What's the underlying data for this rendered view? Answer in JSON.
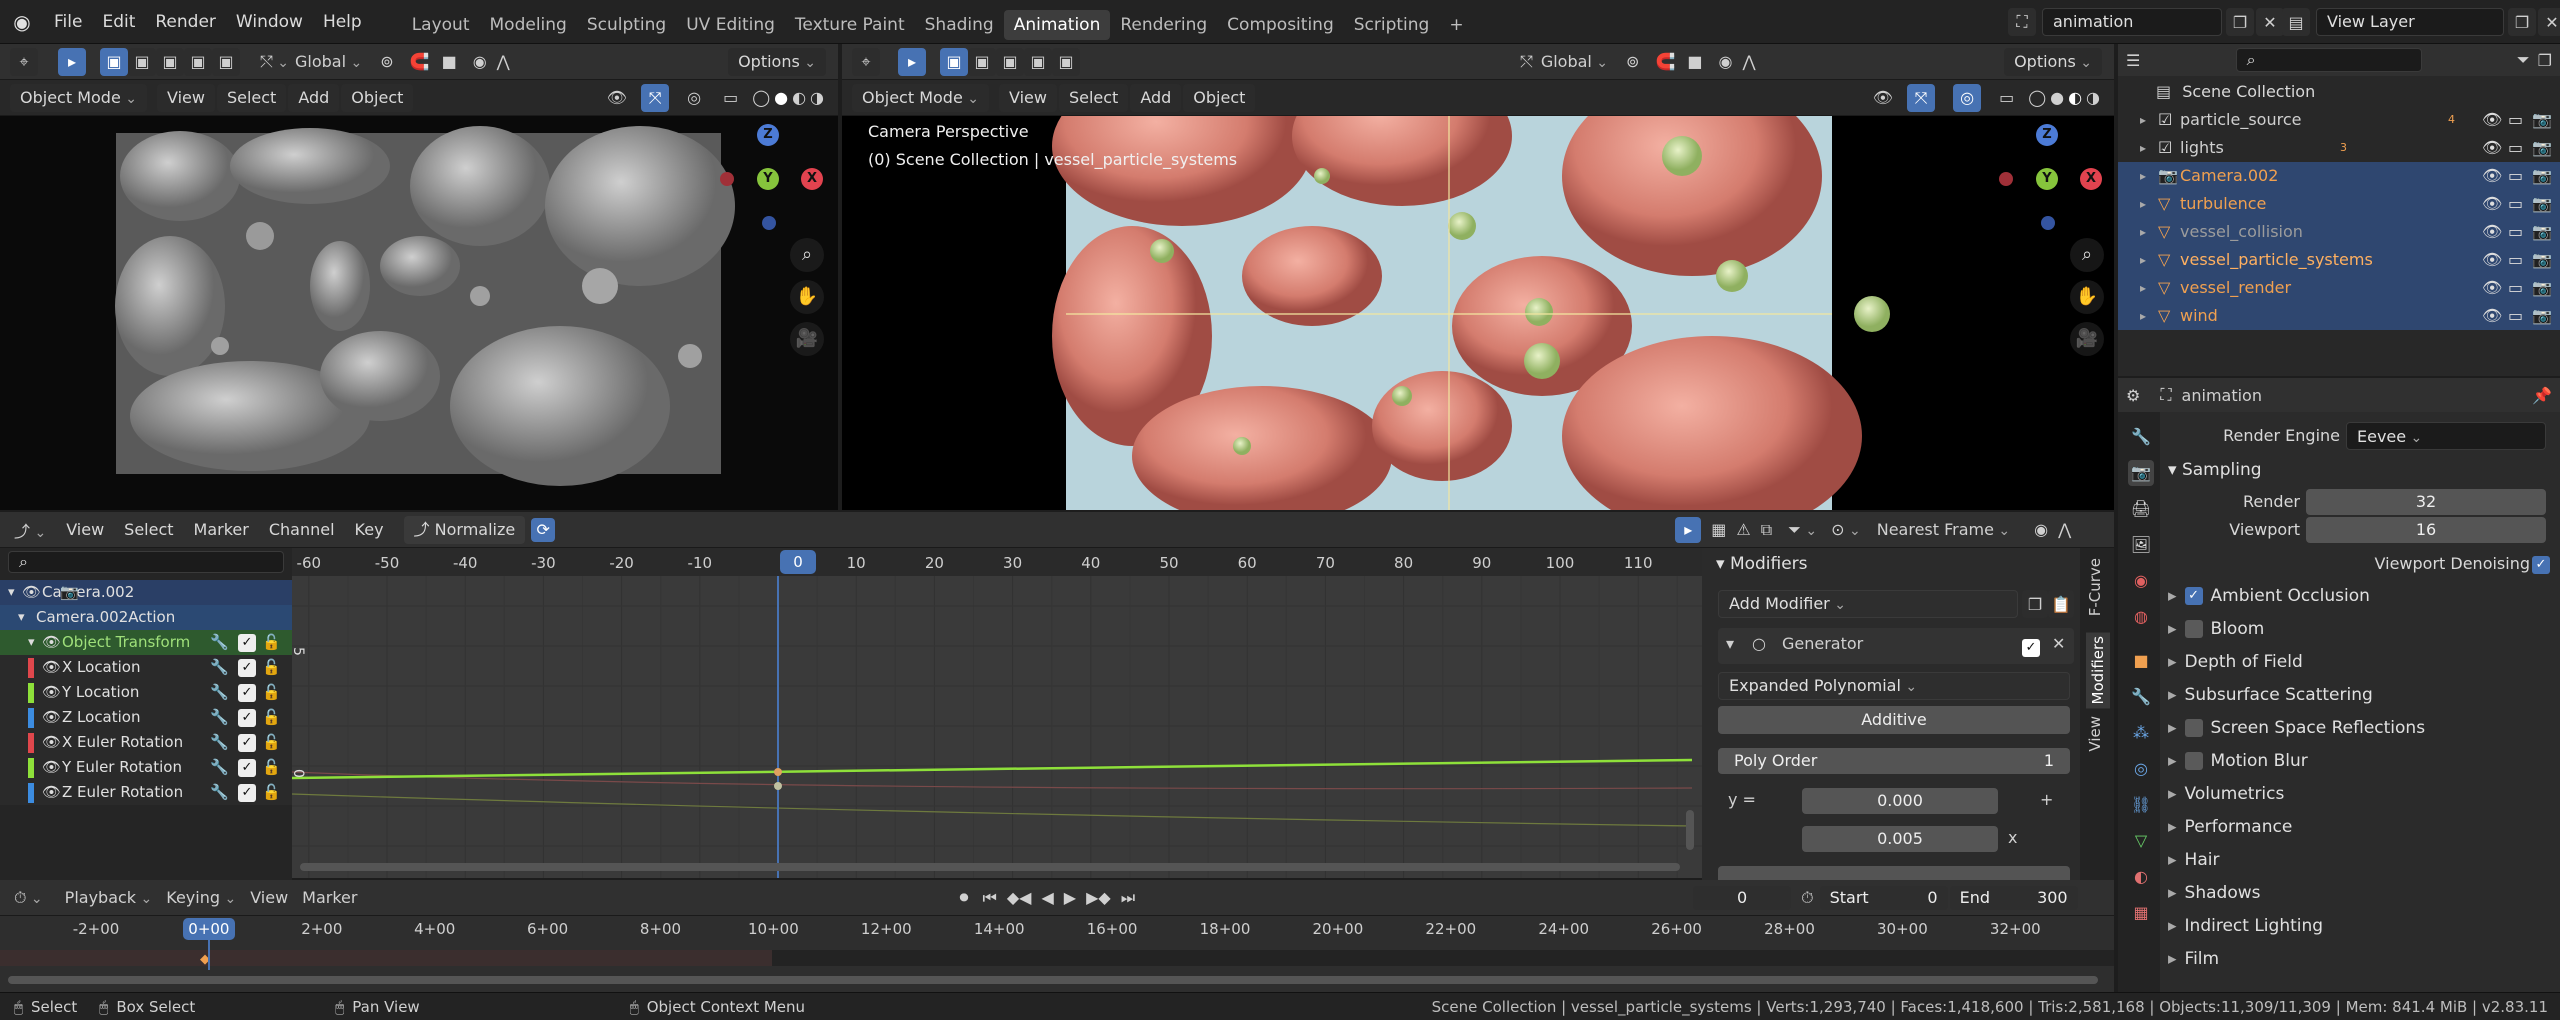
{
  "menubar": {
    "items": [
      "File",
      "Edit",
      "Render",
      "Window",
      "Help"
    ],
    "workspaces": [
      "Layout",
      "Modeling",
      "Sculpting",
      "UV Editing",
      "Texture Paint",
      "Shading",
      "Animation",
      "Rendering",
      "Compositing",
      "Scripting"
    ],
    "active_workspace": "Animation",
    "scene_name": "animation",
    "view_layer": "View Layer"
  },
  "viewport_left": {
    "transform_orientation": "Global",
    "options_label": "Options",
    "mode": "Object Mode",
    "menus": [
      "View",
      "Select",
      "Add",
      "Object"
    ],
    "gizmo": {
      "z": "Z",
      "y": "Y",
      "x": "X"
    }
  },
  "viewport_right": {
    "transform_orientation": "Global",
    "options_label": "Options",
    "mode": "Object Mode",
    "menus": [
      "View",
      "Select",
      "Add",
      "Object"
    ],
    "overlay_line1": "Camera Perspective",
    "overlay_line2": "(0) Scene Collection | vessel_particle_systems",
    "gizmo": {
      "z": "Z",
      "y": "Y",
      "x": "X"
    }
  },
  "outliner": {
    "root": "Scene Collection",
    "rows": [
      {
        "name": "particle_source",
        "selected": false,
        "color": "#d0d0d0",
        "badge": "4"
      },
      {
        "name": "lights",
        "selected": false,
        "color": "#d0d0d0",
        "badge": "3"
      },
      {
        "name": "Camera.002",
        "selected": true,
        "color": "#f0a050",
        "badge": ""
      },
      {
        "name": "turbulence",
        "selected": true,
        "color": "#f0a050",
        "badge": ""
      },
      {
        "name": "vessel_collision",
        "selected": true,
        "color": "#9c9c9c",
        "badge": ""
      },
      {
        "name": "vessel_particle_systems",
        "selected": true,
        "color": "#ffb060",
        "badge": ""
      },
      {
        "name": "vessel_render",
        "selected": true,
        "color": "#f0a050",
        "badge": ""
      },
      {
        "name": "wind",
        "selected": true,
        "color": "#f0a050",
        "badge": ""
      }
    ]
  },
  "properties": {
    "context_label": "animation",
    "render_engine_label": "Render Engine",
    "render_engine_value": "Eevee",
    "sampling_label": "Sampling",
    "render_label": "Render",
    "render_value": "32",
    "viewport_label": "Viewport",
    "viewport_value": "16",
    "viewport_denoising_label": "Viewport Denoising",
    "panels": [
      {
        "label": "Ambient Occlusion",
        "checkbox": true,
        "checked": true
      },
      {
        "label": "Bloom",
        "checkbox": true,
        "checked": false
      },
      {
        "label": "Depth of Field",
        "checkbox": false,
        "checked": false
      },
      {
        "label": "Subsurface Scattering",
        "checkbox": false,
        "checked": false
      },
      {
        "label": "Screen Space Reflections",
        "checkbox": true,
        "checked": false
      },
      {
        "label": "Motion Blur",
        "checkbox": true,
        "checked": false
      },
      {
        "label": "Volumetrics",
        "checkbox": false,
        "checked": false
      },
      {
        "label": "Performance",
        "checkbox": false,
        "checked": false
      },
      {
        "label": "Hair",
        "checkbox": false,
        "checked": false
      },
      {
        "label": "Shadows",
        "checkbox": false,
        "checked": false
      },
      {
        "label": "Indirect Lighting",
        "checkbox": false,
        "checked": false
      },
      {
        "label": "Film",
        "checkbox": false,
        "checked": false
      }
    ]
  },
  "graph_editor": {
    "menus": [
      "View",
      "Select",
      "Marker",
      "Channel",
      "Key"
    ],
    "normalize_label": "Normalize",
    "snap_label": "Nearest Frame",
    "ruler": [
      "-60",
      "-50",
      "-40",
      "-30",
      "-20",
      "-10",
      "0",
      "10",
      "20",
      "30",
      "40",
      "50",
      "60",
      "70",
      "80",
      "90",
      "100",
      "110"
    ],
    "current_frame": "0",
    "y_label_5": "5",
    "y_label_0": "0",
    "channels": [
      {
        "name": "Camera.002",
        "color": "",
        "level": 0
      },
      {
        "name": "Camera.002Action",
        "color": "",
        "level": 1
      },
      {
        "name": "Object Transform",
        "color": "",
        "level": 2
      },
      {
        "name": "X Location",
        "color": "#e0474c",
        "level": 3
      },
      {
        "name": "Y Location",
        "color": "#8ee03a",
        "level": 3
      },
      {
        "name": "Z Location",
        "color": "#3c8ce0",
        "level": 3
      },
      {
        "name": "X Euler Rotation",
        "color": "#e0474c",
        "level": 3
      },
      {
        "name": "Y Euler Rotation",
        "color": "#8ee03a",
        "level": 3
      },
      {
        "name": "Z Euler Rotation",
        "color": "#3c8ce0",
        "level": 3
      }
    ]
  },
  "modifiers_panel": {
    "title": "Modifiers",
    "add_modifier": "Add Modifier",
    "generator_label": "Generator",
    "mode_value": "Expanded Polynomial",
    "additive_label": "Additive",
    "poly_order_label": "Poly Order",
    "poly_order_value": "1",
    "y_eq": "y =",
    "coef0": "0.000",
    "coef1": "0.005",
    "plus": "+",
    "x": "x",
    "tabs": [
      "F-Curve",
      "Modifiers",
      "View"
    ]
  },
  "timeline": {
    "menus": [
      "Playback",
      "Keying",
      "View",
      "Marker"
    ],
    "current_frame": "0",
    "start_label": "Start",
    "start_value": "0",
    "end_label": "End",
    "end_value": "300",
    "ruler": [
      "-2+00",
      "0+00",
      "2+00",
      "4+00",
      "6+00",
      "8+00",
      "10+00",
      "12+00",
      "14+00",
      "16+00",
      "18+00",
      "20+00",
      "22+00",
      "24+00",
      "26+00",
      "28+00",
      "30+00",
      "32+00"
    ]
  },
  "statusbar": {
    "select": "Select",
    "box_select": "Box Select",
    "pan_view": "Pan View",
    "context_menu": "Object Context Menu",
    "stats": "Scene Collection | vessel_particle_systems | Verts:1,293,740 | Faces:1,418,600 | Tris:2,581,168 | Objects:11,309/11,309 | Mem: 841.4 MiB | v2.83.11"
  }
}
